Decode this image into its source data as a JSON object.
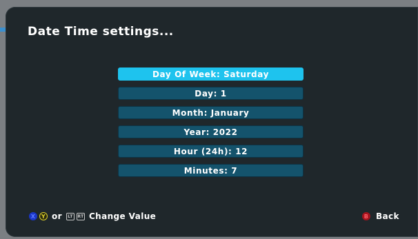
{
  "header": {
    "title": "Date Time settings..."
  },
  "menu": {
    "items": [
      {
        "label": "Day Of Week: Saturday",
        "selected": true
      },
      {
        "label": "Day: 1",
        "selected": false
      },
      {
        "label": "Month: January",
        "selected": false
      },
      {
        "label": "Year: 2022",
        "selected": false
      },
      {
        "label": "Hour (24h): 12",
        "selected": false
      },
      {
        "label": "Minutes: 7",
        "selected": false
      }
    ]
  },
  "footer": {
    "change_hint": {
      "x_glyph": "X",
      "y_glyph": "Y",
      "or_text": "or",
      "lt_glyph": "LT",
      "rt_glyph": "RT",
      "label": "Change Value"
    },
    "back": {
      "b_glyph": "B",
      "label": "Back"
    }
  },
  "colors": {
    "selected_item": "#1ec3ee",
    "item": "#14536c",
    "panel": "#1f272b"
  }
}
